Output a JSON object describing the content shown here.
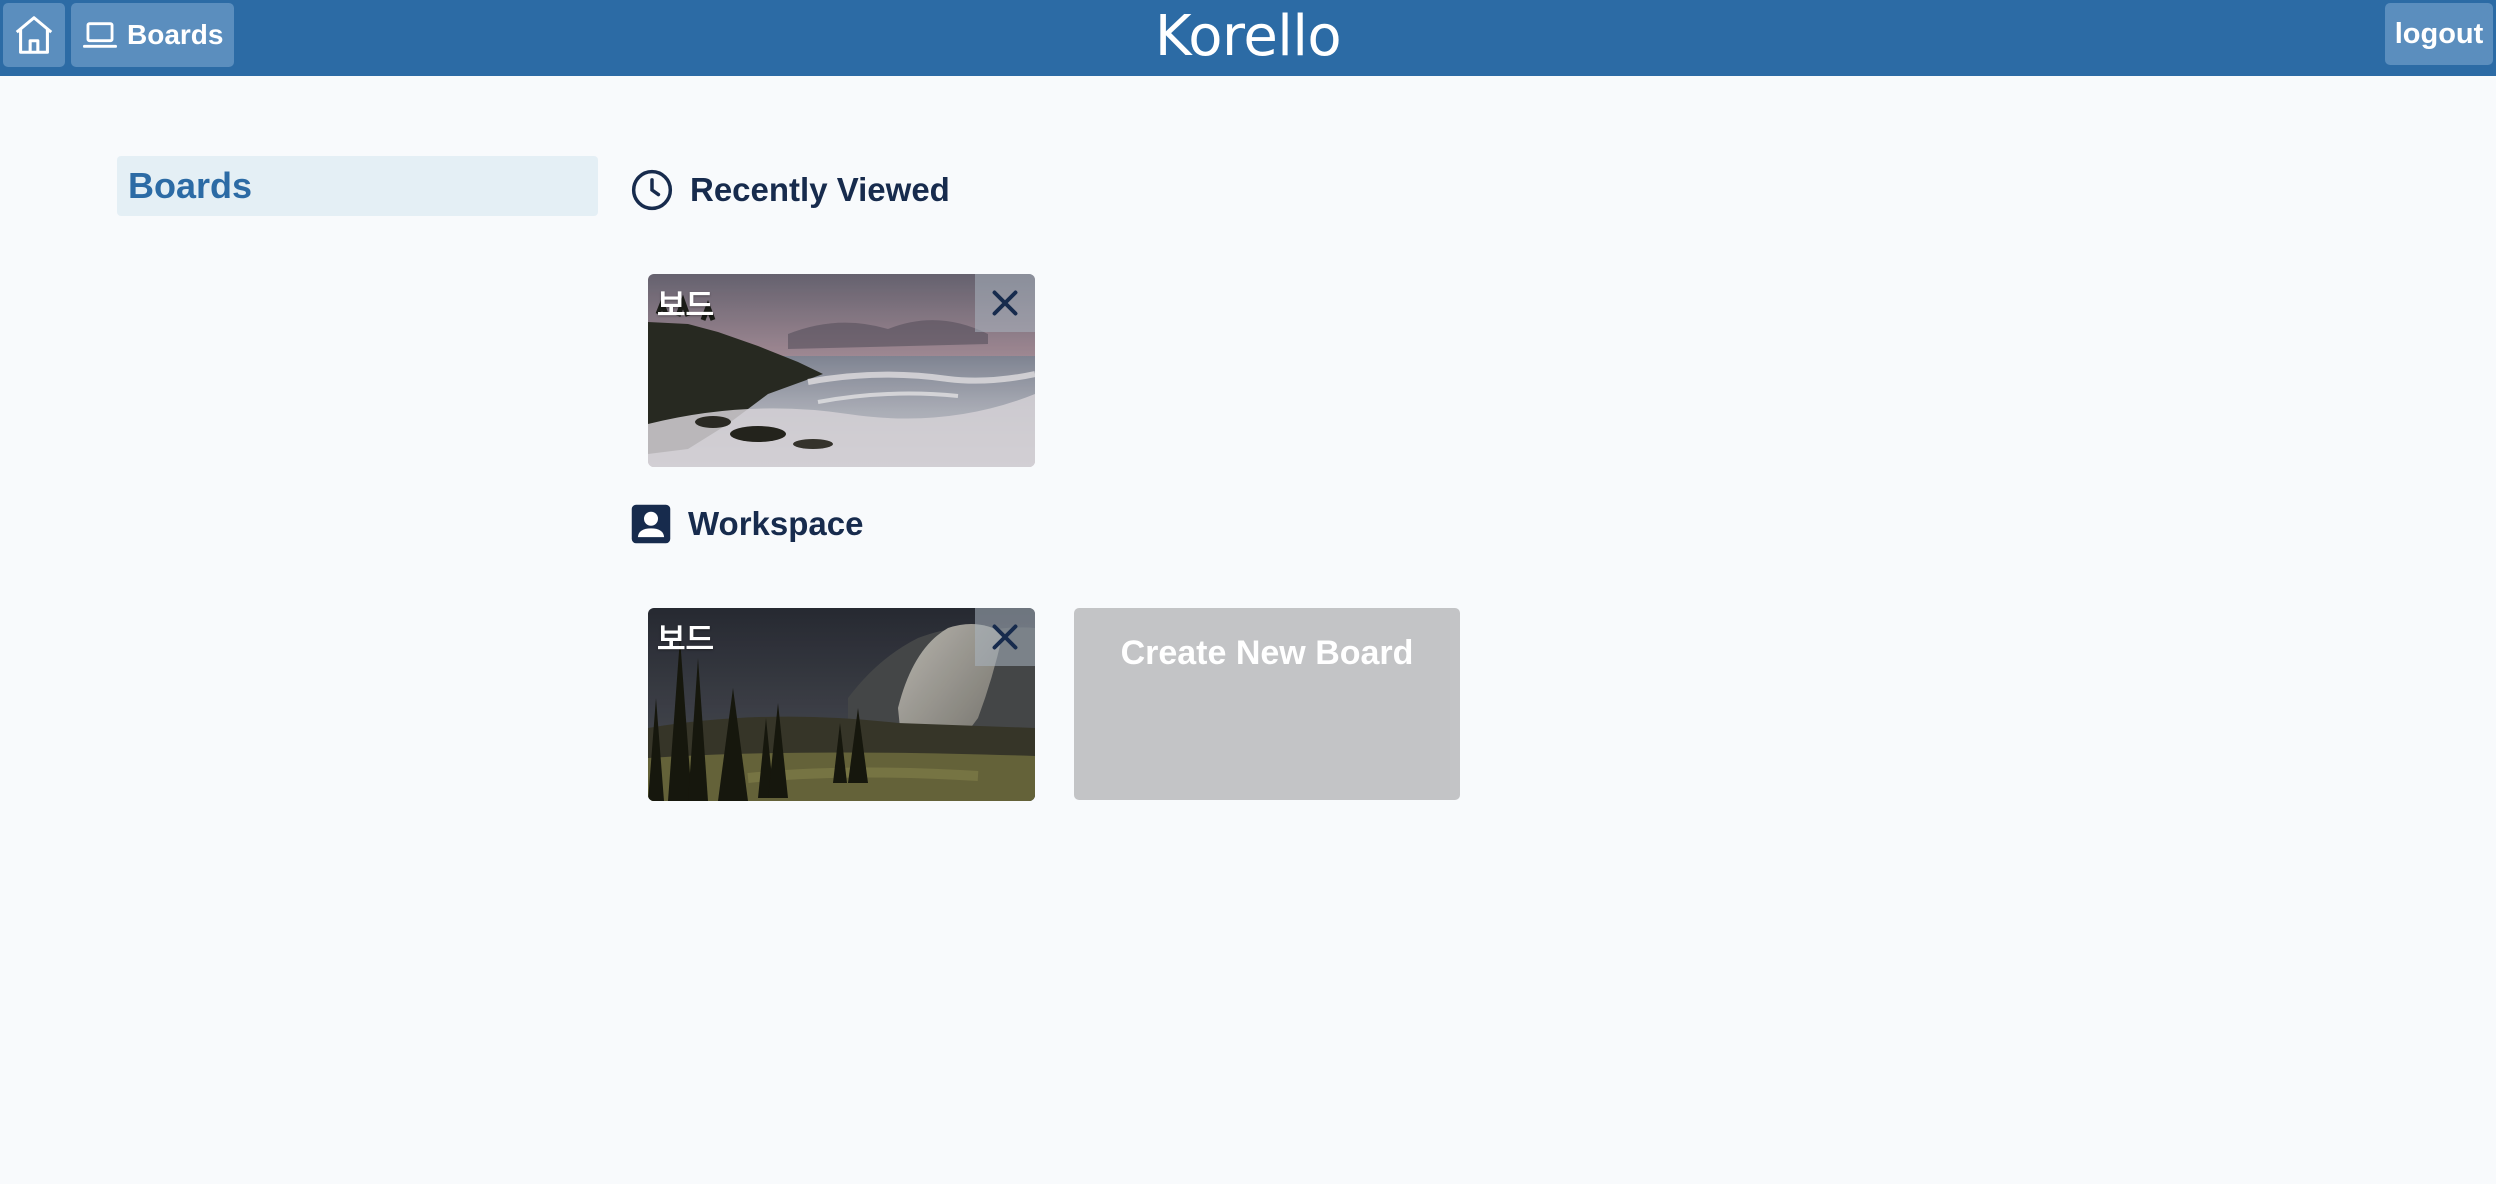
{
  "header": {
    "home_icon": "home-icon",
    "boards_icon": "laptop-icon",
    "boards_label": "Boards",
    "brand": "Korello",
    "logout_label": "logout"
  },
  "sidebar": {
    "items": [
      {
        "label": "Boards"
      }
    ]
  },
  "recent": {
    "icon": "clock-icon",
    "title": "Recently Viewed",
    "boards": [
      {
        "name": "보드",
        "background": "coastal-waves-photo"
      }
    ]
  },
  "workspace": {
    "icon": "user-card-icon",
    "title": "Workspace",
    "boards": [
      {
        "name": "보드",
        "background": "yosemite-forest-photo"
      }
    ],
    "create_label": "Create New Board"
  },
  "colors": {
    "header": "#2c6ba5",
    "header_button": "#5b8ebe",
    "sidebar_active_bg": "#e4eff5",
    "accent_text": "#2c6ba5",
    "heading_text": "#172b4d",
    "page_bg": "#f8fafc",
    "create_card_bg": "#c3c4c6"
  }
}
